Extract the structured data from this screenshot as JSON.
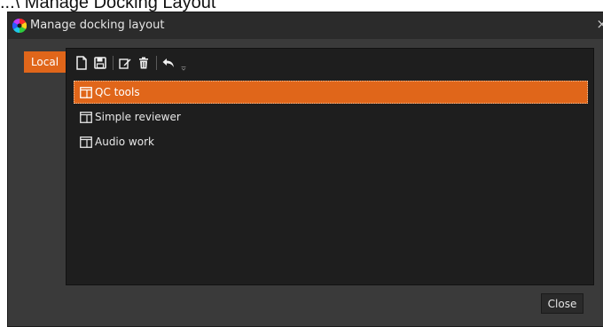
{
  "page_caption": "...\\ Manage Docking Layout",
  "dialog": {
    "title": "Manage docking layout",
    "close_glyph": "×"
  },
  "tabs": {
    "local_label": "Local"
  },
  "toolbar": {
    "buttons": [
      {
        "icon": "new-document-icon"
      },
      {
        "icon": "save-icon"
      },
      {
        "icon": "edit-icon"
      },
      {
        "icon": "delete-icon"
      },
      {
        "icon": "undo-icon"
      },
      {
        "icon": "more-chevron-icon"
      }
    ]
  },
  "layouts": [
    {
      "label": "QC tools",
      "selected": true
    },
    {
      "label": "Simple reviewer",
      "selected": false
    },
    {
      "label": "Audio work",
      "selected": false
    }
  ],
  "footer": {
    "close_label": "Close"
  },
  "colors": {
    "accent": "#e0661a",
    "dialog_bg": "#3a3a3a",
    "panel_bg": "#1e1e1e",
    "titlebar_bg": "#2b2b2b"
  }
}
